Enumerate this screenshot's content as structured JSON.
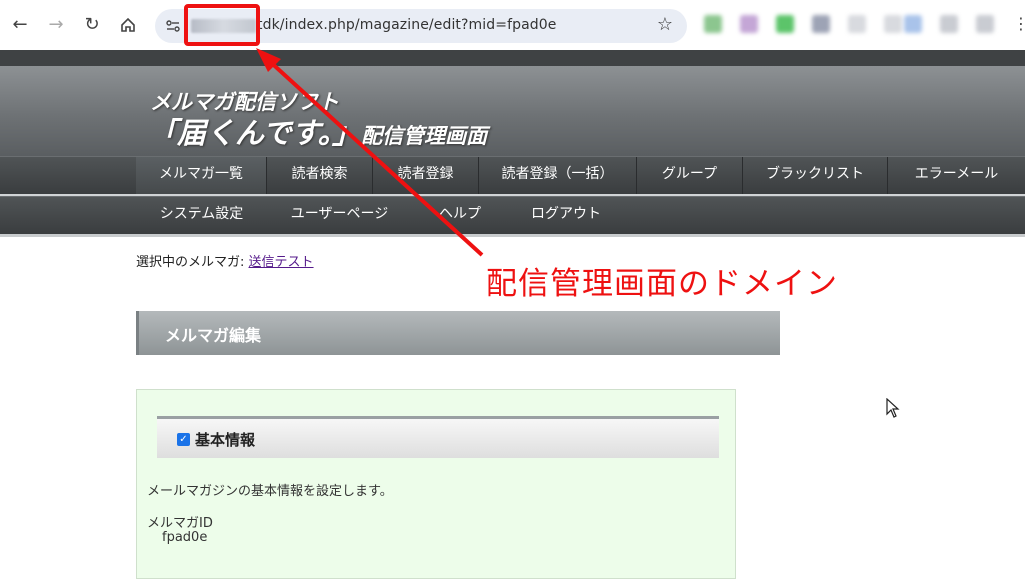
{
  "browser": {
    "url_visible": "tdk/index.php/magazine/edit?mid=fpad0e",
    "back_icon": "arrow-left",
    "forward_icon": "arrow-right",
    "reload_icon": "reload",
    "home_icon": "home",
    "bookmark_icon": "star",
    "menu_icon": "kebab-vertical"
  },
  "header": {
    "line1": "メルマガ配信ソフト",
    "line2_main": "「届くんです。」",
    "line2_sub": "配信管理画面"
  },
  "nav": {
    "row1": [
      "メルマガ一覧",
      "読者検索",
      "読者登録",
      "読者登録（一括）",
      "グループ",
      "ブラックリスト",
      "エラーメール"
    ],
    "row2": [
      "システム設定",
      "ユーザーページ",
      "ヘルプ",
      "ログアウト"
    ],
    "selected": "メルマガ一覧"
  },
  "content": {
    "selected_label": "選択中のメルマガ:",
    "selected_link": "送信テスト",
    "section_title": "メルマガ編集",
    "subsection_title": "基本情報",
    "subsection_checked": true,
    "description": "メールマガジンの基本情報を設定します。",
    "field_label": "メルマガID",
    "field_value": "fpad0e"
  },
  "annotation": {
    "callout": "配信管理画面のドメイン",
    "color": "#ee1111"
  }
}
